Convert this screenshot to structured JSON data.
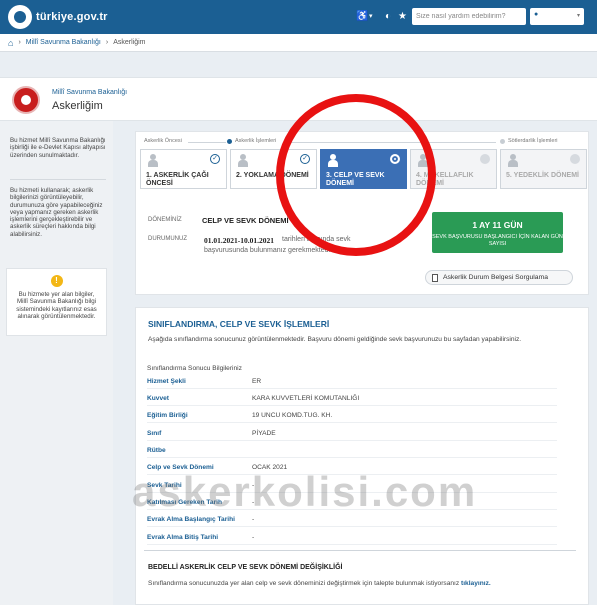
{
  "header": {
    "logo_text": "türkiye.gov.tr",
    "search_placeholder": "Size nasıl yardım edebilirim?",
    "accessibility_icon": "accessibility-icon",
    "lang_caret": "▾",
    "brightness_icon": "brightness-icon",
    "star_icon": "star-icon",
    "user_icon": "user-icon",
    "user_caret": "▾"
  },
  "breadcrumb": {
    "home_icon": "home-icon",
    "items": [
      "Millî Savunma Bakanlığı",
      "Askerliğim"
    ],
    "separator": "›"
  },
  "page": {
    "ministry": "Millî Savunma Bakanlığı",
    "title": "Askerliğim"
  },
  "sidebar": {
    "p1": "Bu hizmet Millî Savunma Bakanlığı işbirliği ile e-Devlet Kapısı altyapısı üzerinden sunulmaktadır.",
    "p2": "Bu hizmeti kullanarak; askerlik bilgilerinizi görüntüleyebilir, durumunuza göre yapabileceğiniz veya yapmanız gereken askerlik işlemlerini gerçekleştirebilir ve askerlik süreçleri hakkında bilgi alabilirsiniz.",
    "info_icon": "info-icon",
    "info_mark": "!",
    "info_text": "Bu hizmete yer alan bilgiler, Millî Savunma Bakanlığı bilgi sistemindeki kayıtlarınız esas alınarak görüntülenmektedir."
  },
  "phases": {
    "before": "Askerlik Öncesi",
    "process": "Askerlik İşlemleri",
    "after": "Sötlerdarlik İşlemleri"
  },
  "steps": [
    {
      "label": "1. ASKERLİK ÇAĞI ÖNCESİ",
      "state": "done"
    },
    {
      "label": "2. YOKLAMA DÖNEMİ",
      "state": "done"
    },
    {
      "label": "3. CELP VE SEVK DÖNEMİ",
      "state": "active"
    },
    {
      "label": "4. MUKELLAFLIK DÖNEMİ",
      "state": "pending"
    },
    {
      "label": "5. YEDEKLİK DÖNEMİ",
      "state": "pending"
    }
  ],
  "status": {
    "term_label": "DÖNEMİNİZ",
    "term_value": "CELP VE SEVK DÖNEMİ",
    "state_label": "DURUMUNUZ",
    "state_value": "01.01.2021-10.01.2021",
    "state_note_1": "tarihleri arasında sevk",
    "state_note_2": "başvurusunda bulunmanız gerekmektedir.",
    "counter_value": "1 AY 11 GÜN",
    "counter_caption": "SEVK BAŞVURUSU BAŞLANGICI İÇİN KALAN GÜN SAYISI",
    "cert_button": "Askerlik Durum Belgesi Sorgulama",
    "cert_icon": "document-icon"
  },
  "classification": {
    "title": "SINIFLANDIRMA, CELP VE SEVK İŞLEMLERİ",
    "description": "Aşağıda sınıflandırma sonucunuz görüntülenmektedir. Başvuru dönemi geldiğinde sevk başvurunuzu bu sayfadan yapabilirsiniz.",
    "results_header": "Sınıflandırma Sonucu Bilgileriniz",
    "rows": [
      {
        "label": "Hizmet Şekli",
        "value": "ER"
      },
      {
        "label": "Kuvvet",
        "value": "KARA KUVVETLERİ KOMUTANLIĞI"
      },
      {
        "label": "Eğitim Birliği",
        "value": "19 UNCU KOMD.TUG. KH."
      },
      {
        "label": "Sınıf",
        "value": "PİYADE"
      },
      {
        "label": "Rütbe",
        "value": ""
      },
      {
        "label": "Celp ve Sevk Dönemi",
        "value": "OCAK 2021"
      },
      {
        "label": "Sevk Tarihi",
        "value": "-"
      },
      {
        "label": "Katılması Gereken Tarih",
        "value": "-"
      },
      {
        "label": "Evrak Alma Başlangıç Tarihi",
        "value": "-"
      },
      {
        "label": "Evrak Alma Bitiş Tarihi",
        "value": "-"
      }
    ],
    "change_title": "BEDELLİ ASKERLİK CELP VE SEVK DÖNEMİ DEĞİŞİKLİĞİ",
    "change_text": "Sınıflandırma sonucunuzda yer alan celp ve sevk döneminizi değiştirmek için talepte bulunmak istiyorsanız",
    "change_link": "tıklayınız."
  },
  "watermark": "askerkolisi.com",
  "colors": {
    "brand": "#1b5f93",
    "active_step": "#3b6fb5",
    "counter": "#2a9b55",
    "annotation_ring": "#e81212"
  }
}
